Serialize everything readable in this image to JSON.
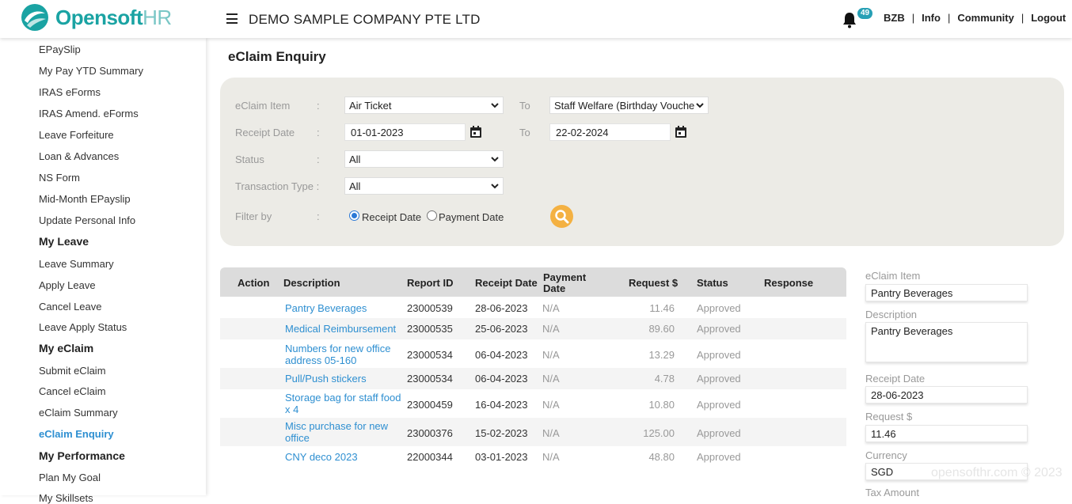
{
  "brand": {
    "name_part1": "Opensoft",
    "name_part2": "HR",
    "colors": {
      "primary": "#1aa3a3",
      "secondary": "#7ac7c6"
    }
  },
  "header": {
    "company": "DEMO SAMPLE COMPANY PTE LTD",
    "notification_count": "49",
    "links": {
      "user": "BZB",
      "info": "Info",
      "community": "Community",
      "logout": "Logout"
    },
    "separator": "|"
  },
  "sidebar": {
    "items_top": [
      "EPaySlip",
      "My Pay YTD Summary",
      "IRAS eForms",
      "IRAS Amend. eForms",
      "Leave Forfeiture",
      "Loan & Advances",
      "NS Form",
      "Mid-Month EPayslip",
      "Update Personal Info"
    ],
    "leave_header": "My Leave",
    "leave_items": [
      "Leave Summary",
      "Apply Leave",
      "Cancel Leave",
      "Leave Apply Status"
    ],
    "eclaim_header": "My eClaim",
    "eclaim_items": [
      "Submit eClaim",
      "Cancel eClaim",
      "eClaim Summary",
      "eClaim Enquiry"
    ],
    "active_item": "eClaim Enquiry",
    "performance_header": "My Performance",
    "performance_items": [
      "Plan My Goal",
      "My Skillsets"
    ]
  },
  "page": {
    "title": "eClaim Enquiry"
  },
  "filters": {
    "colon": ":",
    "to_label": "To",
    "eclaim_item": {
      "label": "eClaim Item",
      "from": "Air Ticket",
      "to": "Staff Welfare (Birthday Vouche"
    },
    "receipt_date": {
      "label": "Receipt Date",
      "from": "01-01-2023",
      "to": "22-02-2024"
    },
    "status": {
      "label": "Status",
      "value": "All"
    },
    "transaction_type": {
      "label": "Transaction Type :",
      "value": "All"
    },
    "filter_by": {
      "label": "Filter by",
      "options": [
        "Receipt Date",
        "Payment Date"
      ],
      "selected": "Receipt Date"
    }
  },
  "table": {
    "headers": {
      "action": "Action",
      "description": "Description",
      "report_id": "Report ID",
      "receipt_date": "Receipt Date",
      "payment_date_1": "Payment",
      "payment_date_2": "Date",
      "request": "Request $",
      "status": "Status",
      "response": "Response"
    },
    "rows": [
      {
        "description": "Pantry Beverages",
        "report_id": "23000539",
        "receipt_date": "28-06-2023",
        "payment_date": "N/A",
        "request": "11.46",
        "status": "Approved"
      },
      {
        "description": "Medical Reimbursement",
        "report_id": "23000535",
        "receipt_date": "25-06-2023",
        "payment_date": "N/A",
        "request": "89.60",
        "status": "Approved"
      },
      {
        "description": "Numbers for new office address 05-160",
        "report_id": "23000534",
        "receipt_date": "06-04-2023",
        "payment_date": "N/A",
        "request": "13.29",
        "status": "Approved"
      },
      {
        "description": "Pull/Push stickers",
        "report_id": "23000534",
        "receipt_date": "06-04-2023",
        "payment_date": "N/A",
        "request": "4.78",
        "status": "Approved"
      },
      {
        "description": "Storage bag for staff food x 4",
        "report_id": "23000459",
        "receipt_date": "16-04-2023",
        "payment_date": "N/A",
        "request": "10.80",
        "status": "Approved"
      },
      {
        "description": "Misc purchase for new office",
        "report_id": "23000376",
        "receipt_date": "15-02-2023",
        "payment_date": "N/A",
        "request": "125.00",
        "status": "Approved"
      },
      {
        "description": "CNY deco 2023",
        "report_id": "22000344",
        "receipt_date": "03-01-2023",
        "payment_date": "N/A",
        "request": "48.80",
        "status": "Approved"
      }
    ]
  },
  "detail": {
    "eclaim_item_label": "eClaim Item",
    "eclaim_item": "Pantry Beverages",
    "description_label": "Description",
    "description": "Pantry Beverages",
    "receipt_date_label": "Receipt Date",
    "receipt_date": "28-06-2023",
    "request_label": "Request $",
    "request": "11.46",
    "currency_label": "Currency",
    "currency": "SGD",
    "tax_amount_label": "Tax Amount"
  },
  "footer": {
    "watermark": "opensofthr.com © 2023"
  }
}
